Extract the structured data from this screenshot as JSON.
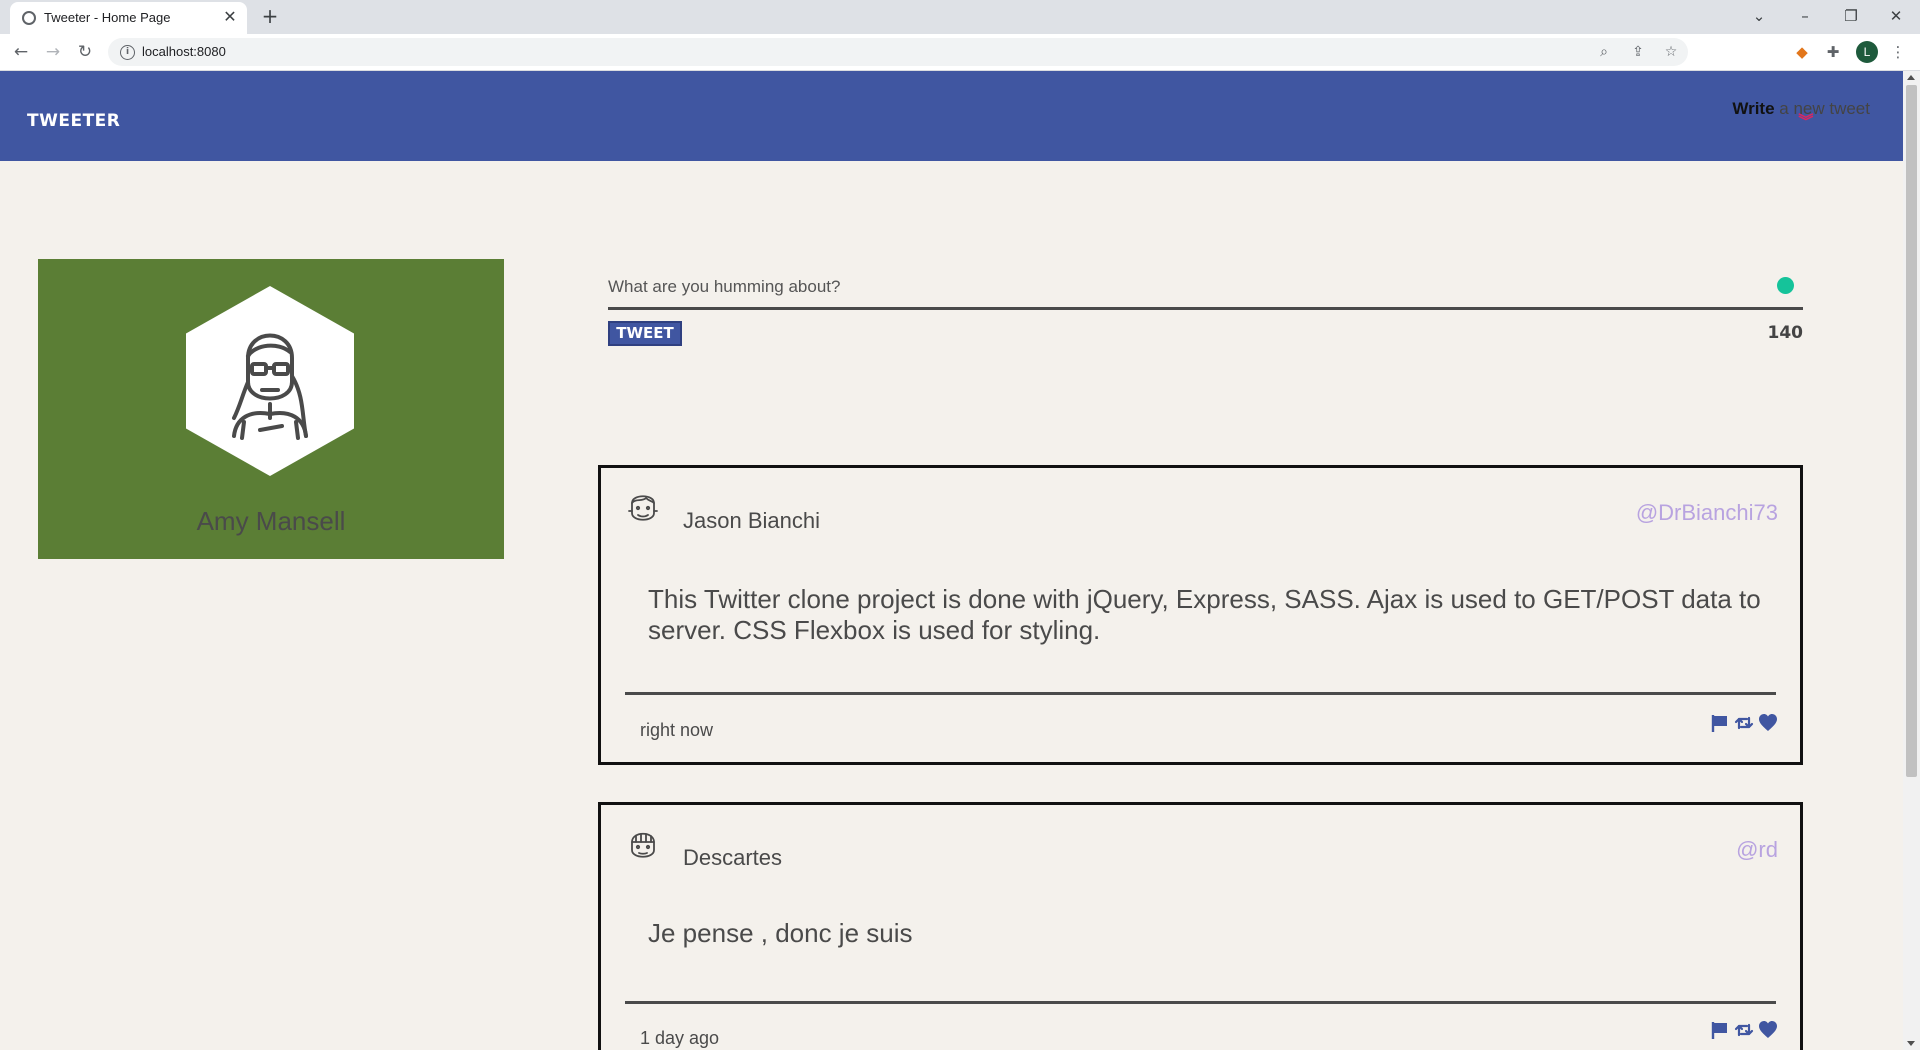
{
  "browser": {
    "tab_title": "Tweeter - Home Page",
    "url": "localhost:8080",
    "profile_initial": "L"
  },
  "nav": {
    "brand": "TWEETER",
    "compose_strong": "Write",
    "compose_rest": " a new tweet"
  },
  "profile": {
    "name": "Amy Mansell"
  },
  "composer": {
    "placeholder": "What are you humming about?",
    "button_label": "TWEET",
    "counter": "140"
  },
  "tweets": [
    {
      "name": "Jason Bianchi",
      "handle": "@DrBianchi73",
      "text": "This Twitter clone project is done with jQuery, Express, SASS. Ajax is used to GET/POST data to server. CSS Flexbox is used for styling.",
      "time": "right now"
    },
    {
      "name": "Descartes",
      "handle": "@rd",
      "text": "Je pense , donc je suis",
      "time": "1 day ago"
    }
  ],
  "icons": {
    "flag": "flag-icon",
    "retweet": "retweet-icon",
    "heart": "heart-icon"
  },
  "colors": {
    "nav": "#4056a1",
    "profile_card": "#5b7e35",
    "handle": "#b8a3e0",
    "background": "#f4f1ec"
  }
}
